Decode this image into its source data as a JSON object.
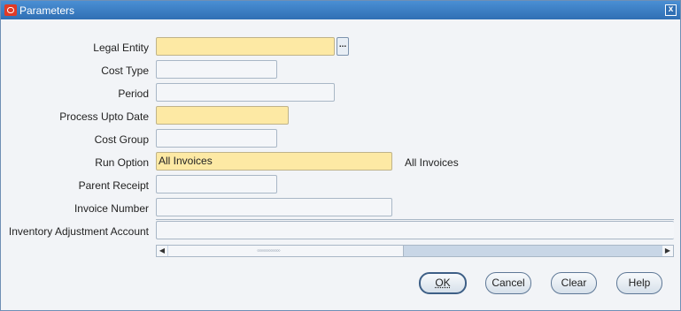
{
  "window": {
    "title": "Parameters",
    "close": "x"
  },
  "fields": [
    {
      "label": "Legal Entity",
      "value": "",
      "required": true
    },
    {
      "label": "Cost Type",
      "value": ""
    },
    {
      "label": "Period",
      "value": ""
    },
    {
      "label": "Process Upto Date",
      "value": "",
      "required": true
    },
    {
      "label": "Cost Group",
      "value": ""
    },
    {
      "label": "Run Option",
      "value": "All Invoices",
      "required": true,
      "description": "All Invoices"
    },
    {
      "label": "Parent Receipt",
      "value": ""
    },
    {
      "label": "Invoice Number",
      "value": ""
    },
    {
      "label": "Inventory Adjustment Account",
      "value": ""
    }
  ],
  "lov_button": "...",
  "scrollbar": {
    "left_arrow": "◀",
    "right_arrow": "▶",
    "grip": "◦◦◦◦◦◦◦◦◦◦◦◦◦◦"
  },
  "buttons": {
    "ok": "OK",
    "cancel": "Cancel",
    "clear": "Clear",
    "help": "Help"
  },
  "colors": {
    "required_field": "#fde9a4",
    "titlebar": "#3a7dc3"
  }
}
